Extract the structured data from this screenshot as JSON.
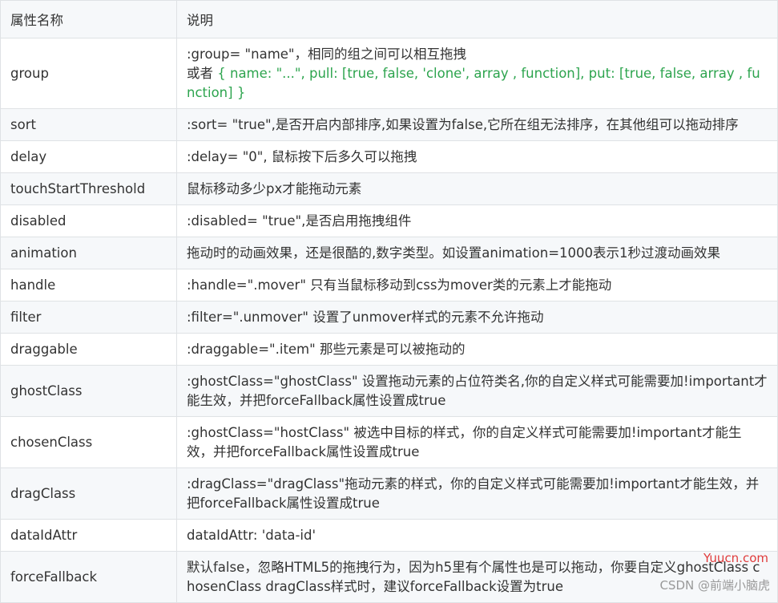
{
  "table": {
    "headers": {
      "name": "属性名称",
      "desc": "说明"
    },
    "group": {
      "name": "group",
      "line1": ":group= \"name\"，相同的组之间可以相互拖拽",
      "line2_prefix": "或者 ",
      "line2_code": "{ name: \"...\", pull: [true, false, 'clone', array , function], put: [true, false, array , function] }"
    },
    "rows": [
      {
        "name": "sort",
        "desc": ":sort= \"true\",是否开启内部排序,如果设置为false,它所在组无法排序，在其他组可以拖动排序"
      },
      {
        "name": "delay",
        "desc": ":delay= \"0\", 鼠标按下后多久可以拖拽"
      },
      {
        "name": "touchStartThreshold",
        "desc": "鼠标移动多少px才能拖动元素"
      },
      {
        "name": "disabled",
        "desc": ":disabled= \"true\",是否启用拖拽组件"
      },
      {
        "name": "animation",
        "desc": "拖动时的动画效果，还是很酷的,数字类型。如设置animation=1000表示1秒过渡动画效果"
      },
      {
        "name": "handle",
        "desc": ":handle=\".mover\" 只有当鼠标移动到css为mover类的元素上才能拖动"
      },
      {
        "name": "filter",
        "desc": ":filter=\".unmover\" 设置了unmover样式的元素不允许拖动"
      },
      {
        "name": "draggable",
        "desc": ":draggable=\".item\" 那些元素是可以被拖动的"
      },
      {
        "name": "ghostClass",
        "desc": ":ghostClass=\"ghostClass\" 设置拖动元素的占位符类名,你的自定义样式可能需要加!important才能生效，并把forceFallback属性设置成true"
      },
      {
        "name": "chosenClass",
        "desc": ":ghostClass=\"hostClass\" 被选中目标的样式，你的自定义样式可能需要加!important才能生效，并把forceFallback属性设置成true"
      },
      {
        "name": "dragClass",
        "desc": ":dragClass=\"dragClass\"拖动元素的样式，你的自定义样式可能需要加!important才能生效，并把forceFallback属性设置成true"
      },
      {
        "name": "dataIdAttr",
        "desc": "dataIdAttr: 'data-id'"
      },
      {
        "name": "forceFallback",
        "desc": "默认false，忽略HTML5的拖拽行为，因为h5里有个属性也是可以拖动，你要自定义ghostClass chosenClass dragClass样式时，建议forceFallback设置为true"
      }
    ]
  },
  "watermarks": {
    "site": "Yuucn.com",
    "csdn": "CSDN @前端小脑虎"
  },
  "colors": {
    "header_bg": "#f6f8fa",
    "border": "#dfe2e5",
    "code_green": "#2da44e",
    "text": "#333333",
    "watermark_red": "#e03c3c"
  }
}
